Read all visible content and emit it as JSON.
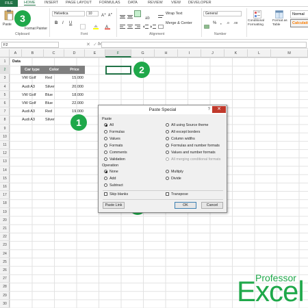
{
  "ribbon": {
    "tabs": [
      "FILE",
      "HOME",
      "INSERT",
      "PAGE LAYOUT",
      "FORMULAS",
      "DATA",
      "REVIEW",
      "VIEW",
      "DEVELOPER"
    ],
    "clipboard": {
      "paste": "Paste",
      "format_painter": "Format Painter",
      "group_label": "Clipboard"
    },
    "font": {
      "name": "Helvetica",
      "size": "10",
      "group_label": "Font",
      "bold": "B",
      "italic": "I",
      "underline": "U"
    },
    "alignment": {
      "wrap_text": "Wrap Text",
      "merge": "Merge & Center",
      "group_label": "Alignment"
    },
    "number": {
      "format": "General",
      "percent": "%",
      "comma": ",",
      "group_label": "Number"
    },
    "styles": {
      "conditional": "Conditional Formatting",
      "format_as_table": "Format as Table",
      "normal": "Normal",
      "calculation": "Calculatio"
    }
  },
  "formula_bar": {
    "name_box": "F2",
    "fx": "fx",
    "content": ""
  },
  "columns": [
    "A",
    "B",
    "C",
    "D",
    "E",
    "F",
    "G",
    "H",
    "I",
    "J",
    "K",
    "L",
    "M"
  ],
  "selected_column": "F",
  "selected_row": "2",
  "rows": [
    "1",
    "2",
    "3",
    "4",
    "5",
    "6",
    "7",
    "8",
    "9",
    "10",
    "11",
    "12",
    "13",
    "14",
    "15",
    "16",
    "17",
    "18",
    "19",
    "20",
    "21",
    "22",
    "23",
    "24",
    "25",
    "26",
    "27",
    "28",
    "29",
    "30"
  ],
  "sheet": {
    "title": "Data",
    "headers": [
      "Car type",
      "Color",
      "Price"
    ],
    "data": [
      [
        "VW Golf",
        "Red",
        "15.000"
      ],
      [
        "Audi A3",
        "Silver",
        "20.000"
      ],
      [
        "VW Golf",
        "Blue",
        "18.000"
      ],
      [
        "VW Golf",
        "Blue",
        "22.000"
      ],
      [
        "Audi A3",
        "Red",
        "19.000"
      ],
      [
        "Audi A3",
        "Silver",
        "21.000"
      ]
    ]
  },
  "badges": [
    "1",
    "2",
    "3",
    "4"
  ],
  "dialog": {
    "title": "Paste Special",
    "help": "?",
    "close": "✕",
    "paste_label": "Paste",
    "paste_left": [
      "All",
      "Formulas",
      "Values",
      "Formats",
      "Comments",
      "Validation"
    ],
    "paste_right": [
      "All using Source theme",
      "All except borders",
      "Column widths",
      "Formulas and number formats",
      "Values and number formats",
      "All merging conditional formats"
    ],
    "operation_label": "Operation",
    "operation_left": [
      "None",
      "Add",
      "Subtract"
    ],
    "operation_right": [
      "Multiply",
      "Divide"
    ],
    "skip_blanks": "Skip blanks",
    "transpose": "Transpose",
    "paste_link": "Paste Link",
    "ok": "OK",
    "cancel": "Cancel"
  },
  "logo": {
    "top": "Professor",
    "main": "Excel"
  },
  "colors": {
    "excel_green": "#217346",
    "badge_green": "#1fa84a",
    "header_gray": "#7f7f7f",
    "close_red": "#c0392b"
  }
}
